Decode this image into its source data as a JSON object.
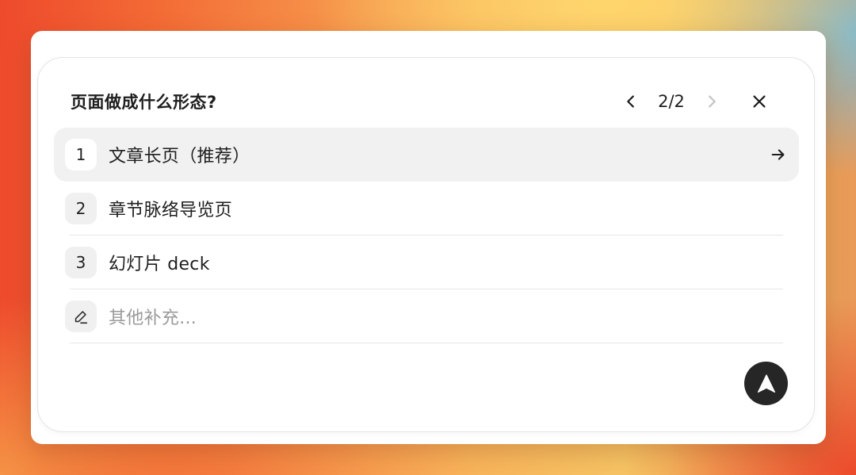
{
  "question": {
    "title": "页面做成什么形态?"
  },
  "pager": {
    "indicator": "2/2"
  },
  "options": [
    {
      "number": "1",
      "label": "文章长页（推荐）",
      "selected": true
    },
    {
      "number": "2",
      "label": "章节脉络导览页",
      "selected": false
    },
    {
      "number": "3",
      "label": "幻灯片 deck",
      "selected": false
    }
  ],
  "custom": {
    "placeholder": "其他补充..."
  },
  "icons": {
    "prev": "chevron-left-icon",
    "next": "chevron-right-icon",
    "close": "close-icon",
    "arrow": "arrow-right-icon",
    "pencil": "pencil-icon",
    "submit": "navigation-arrow-icon"
  },
  "colors": {
    "selected_bg": "#f1f1f1",
    "submit_bg": "#262626",
    "disabled_chevron": "#c4c4c4"
  }
}
